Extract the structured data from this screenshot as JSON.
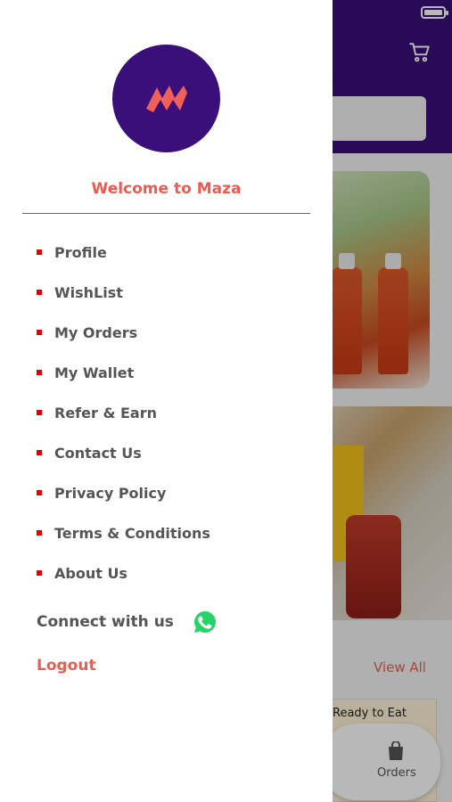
{
  "drawer": {
    "welcome_text": "Welcome to Maza",
    "menu_items": [
      {
        "label": "Profile"
      },
      {
        "label": "WishList"
      },
      {
        "label": "My Orders"
      },
      {
        "label": "My Wallet"
      },
      {
        "label": "Refer & Earn"
      },
      {
        "label": "Contact Us"
      },
      {
        "label": "Privacy Policy"
      },
      {
        "label": "Terms & Conditions"
      },
      {
        "label": "About Us"
      }
    ],
    "connect_label": "Connect with us",
    "connect_icon": "whatsapp-icon",
    "logout_label": "Logout"
  },
  "background": {
    "view_all": "View All",
    "card_title": "Ready to Eat",
    "nav_orders": "Orders",
    "header_color": "#3a0f7a",
    "accent": "#ef5a4f"
  }
}
